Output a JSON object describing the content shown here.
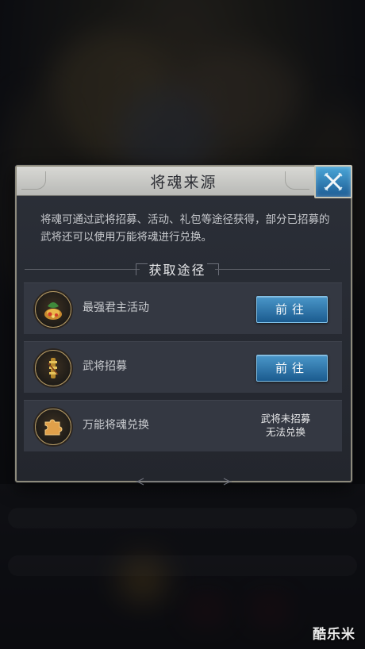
{
  "dialog": {
    "title": "将魂来源",
    "description": "将魂可通过武将招募、活动、礼包等途径获得，部分已招募的武将还可以使用万能将魂进行兑换。",
    "section_title": "获取途径",
    "rows": [
      {
        "label": "最强君主活动",
        "action_label": "前往",
        "icon": "treasure-bag-icon"
      },
      {
        "label": "武将招募",
        "action_label": "前往",
        "icon": "scroll-icon"
      },
      {
        "label": "万能将魂兑换",
        "status_line1": "武将未招募",
        "status_line2": "无法兑换",
        "icon": "puzzle-piece-icon"
      }
    ]
  },
  "watermark": "酷乐米",
  "colors": {
    "button_blue": "#2a7ab6",
    "dialog_bg": "#272a31",
    "title_bar": "#c9cac7"
  }
}
